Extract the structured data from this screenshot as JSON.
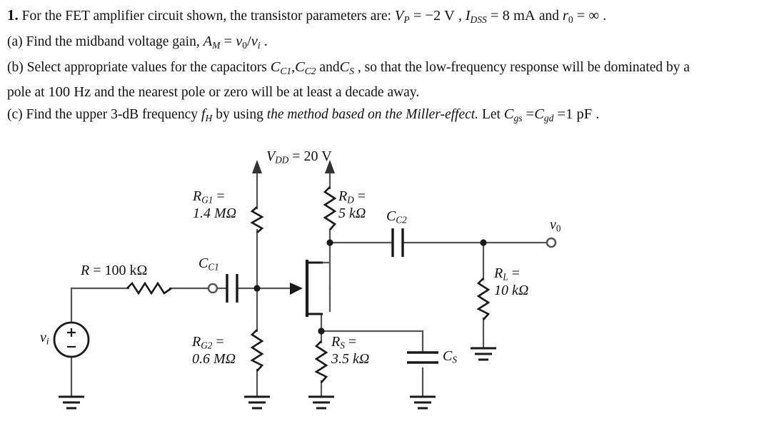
{
  "document": {
    "type": "homework-problem",
    "number": "1.",
    "lines": [
      {
        "id": "intro",
        "prefix": "1.",
        "text": "For the FET amplifier circuit shown, the transistor parameters are:",
        "math": "V_P = -2 V , I_DSS = 8 mA and r_0 = ∞ ."
      },
      {
        "id": "part-a",
        "prefix": "(a)",
        "text": "Find the midband voltage gain,",
        "math": "A_M = v_0 / v_i ."
      },
      {
        "id": "part-b",
        "prefix": "(b)",
        "text": "Select appropriate values for the capacitors C_C1, C_C2 and C_S , so that the low-frequency response will be dominated by a pole at 100 Hz and the nearest pole or zero will be at least a decade away."
      },
      {
        "id": "part-c",
        "prefix": "(c)",
        "text": "Find the upper 3-dB frequency f_H by using the method based on the Miller-effect. Let C_gs = C_gd = 1 pF ."
      }
    ],
    "text_fragments": {
      "intro_a": "For the FET amplifier circuit shown, the transistor parameters are:",
      "intro_and1": "and",
      "intro_and2": "and",
      "a_text": "Find the midband voltage gain,",
      "b_text1": "Select appropriate values for the capacitors",
      "b_and": "and",
      "b_text2": ", so that the low-frequency response will be dominated by a",
      "b_text3": "pole at",
      "b_text4": "and the nearest pole or zero will be at least a decade away.",
      "c_text1": "Find the upper 3-dB frequency",
      "c_text2": "by using",
      "c_emph": "the method based on the Miller-effect.",
      "c_text3": "Let"
    },
    "symbols": {
      "vp": "V",
      "vp_sub": "P",
      "vp_val": "= −2 V",
      "idss": "I",
      "idss_sub": "DSS",
      "idss_val": "= 8 mA",
      "r0": "r",
      "r0_sub": "0",
      "r0_val": "= ∞ .",
      "am": "A",
      "am_sub": "M",
      "am_eq": "=",
      "am_num": "v",
      "am_num_sub": "0",
      "am_slash": "/",
      "am_den": "v",
      "am_den_sub": "i",
      "am_period": ".",
      "cc1": "C",
      "cc1_sub": "C1",
      "cc2": "C",
      "cc2_sub": "C2",
      "cs": "C",
      "cs_sub": "S",
      "hundred_hz": "100 Hz",
      "fh": "f",
      "fh_sub": "H",
      "cgs": "C",
      "cgs_sub": "gs",
      "cgd": "C",
      "cgd_sub": "gd",
      "cgs_val": "=1  pF ."
    }
  },
  "circuit": {
    "title": "FET common-source amplifier circuit",
    "supply": {
      "name": "V",
      "sub": "DD",
      "value": "= 20 V"
    },
    "components": [
      {
        "id": "rg1",
        "type": "resistor",
        "name": "R",
        "sub": "G1",
        "eq": "=",
        "value": "1.4 MΩ"
      },
      {
        "id": "rd",
        "type": "resistor",
        "name": "R",
        "sub": "D",
        "eq": "=",
        "value": "5 kΩ"
      },
      {
        "id": "rg2",
        "type": "resistor",
        "name": "R",
        "sub": "G2",
        "eq": "=",
        "value": "0.6 MΩ"
      },
      {
        "id": "rs",
        "type": "resistor",
        "name": "R",
        "sub": "S",
        "eq": "=",
        "value": "3.5 kΩ"
      },
      {
        "id": "rl",
        "type": "resistor",
        "name": "R",
        "sub": "L",
        "eq": "=",
        "value": "10 kΩ"
      },
      {
        "id": "rsrc",
        "type": "resistor",
        "name": "R",
        "sub": "",
        "eq": "=",
        "value": "100 kΩ"
      },
      {
        "id": "cc1",
        "type": "capacitor",
        "name": "C",
        "sub": "C1",
        "eq": "",
        "value": ""
      },
      {
        "id": "cc2",
        "type": "capacitor",
        "name": "C",
        "sub": "C2",
        "eq": "",
        "value": ""
      },
      {
        "id": "cs",
        "type": "capacitor",
        "name": "C",
        "sub": "S",
        "eq": "",
        "value": ""
      },
      {
        "id": "vi",
        "type": "voltage-source",
        "name": "v",
        "sub": "i",
        "eq": "",
        "value": ""
      },
      {
        "id": "vo",
        "type": "output-terminal",
        "name": "v",
        "sub": "0",
        "eq": "",
        "value": ""
      },
      {
        "id": "jfet",
        "type": "n-channel-jfet",
        "name": "",
        "sub": "",
        "eq": "",
        "value": ""
      }
    ],
    "source_label": {
      "name": "R",
      "eq": "= 100 kΩ"
    },
    "colors": {
      "wire": "#555555",
      "device": "#1a1a1a",
      "text": "#111111",
      "background": "#ffffff"
    }
  }
}
